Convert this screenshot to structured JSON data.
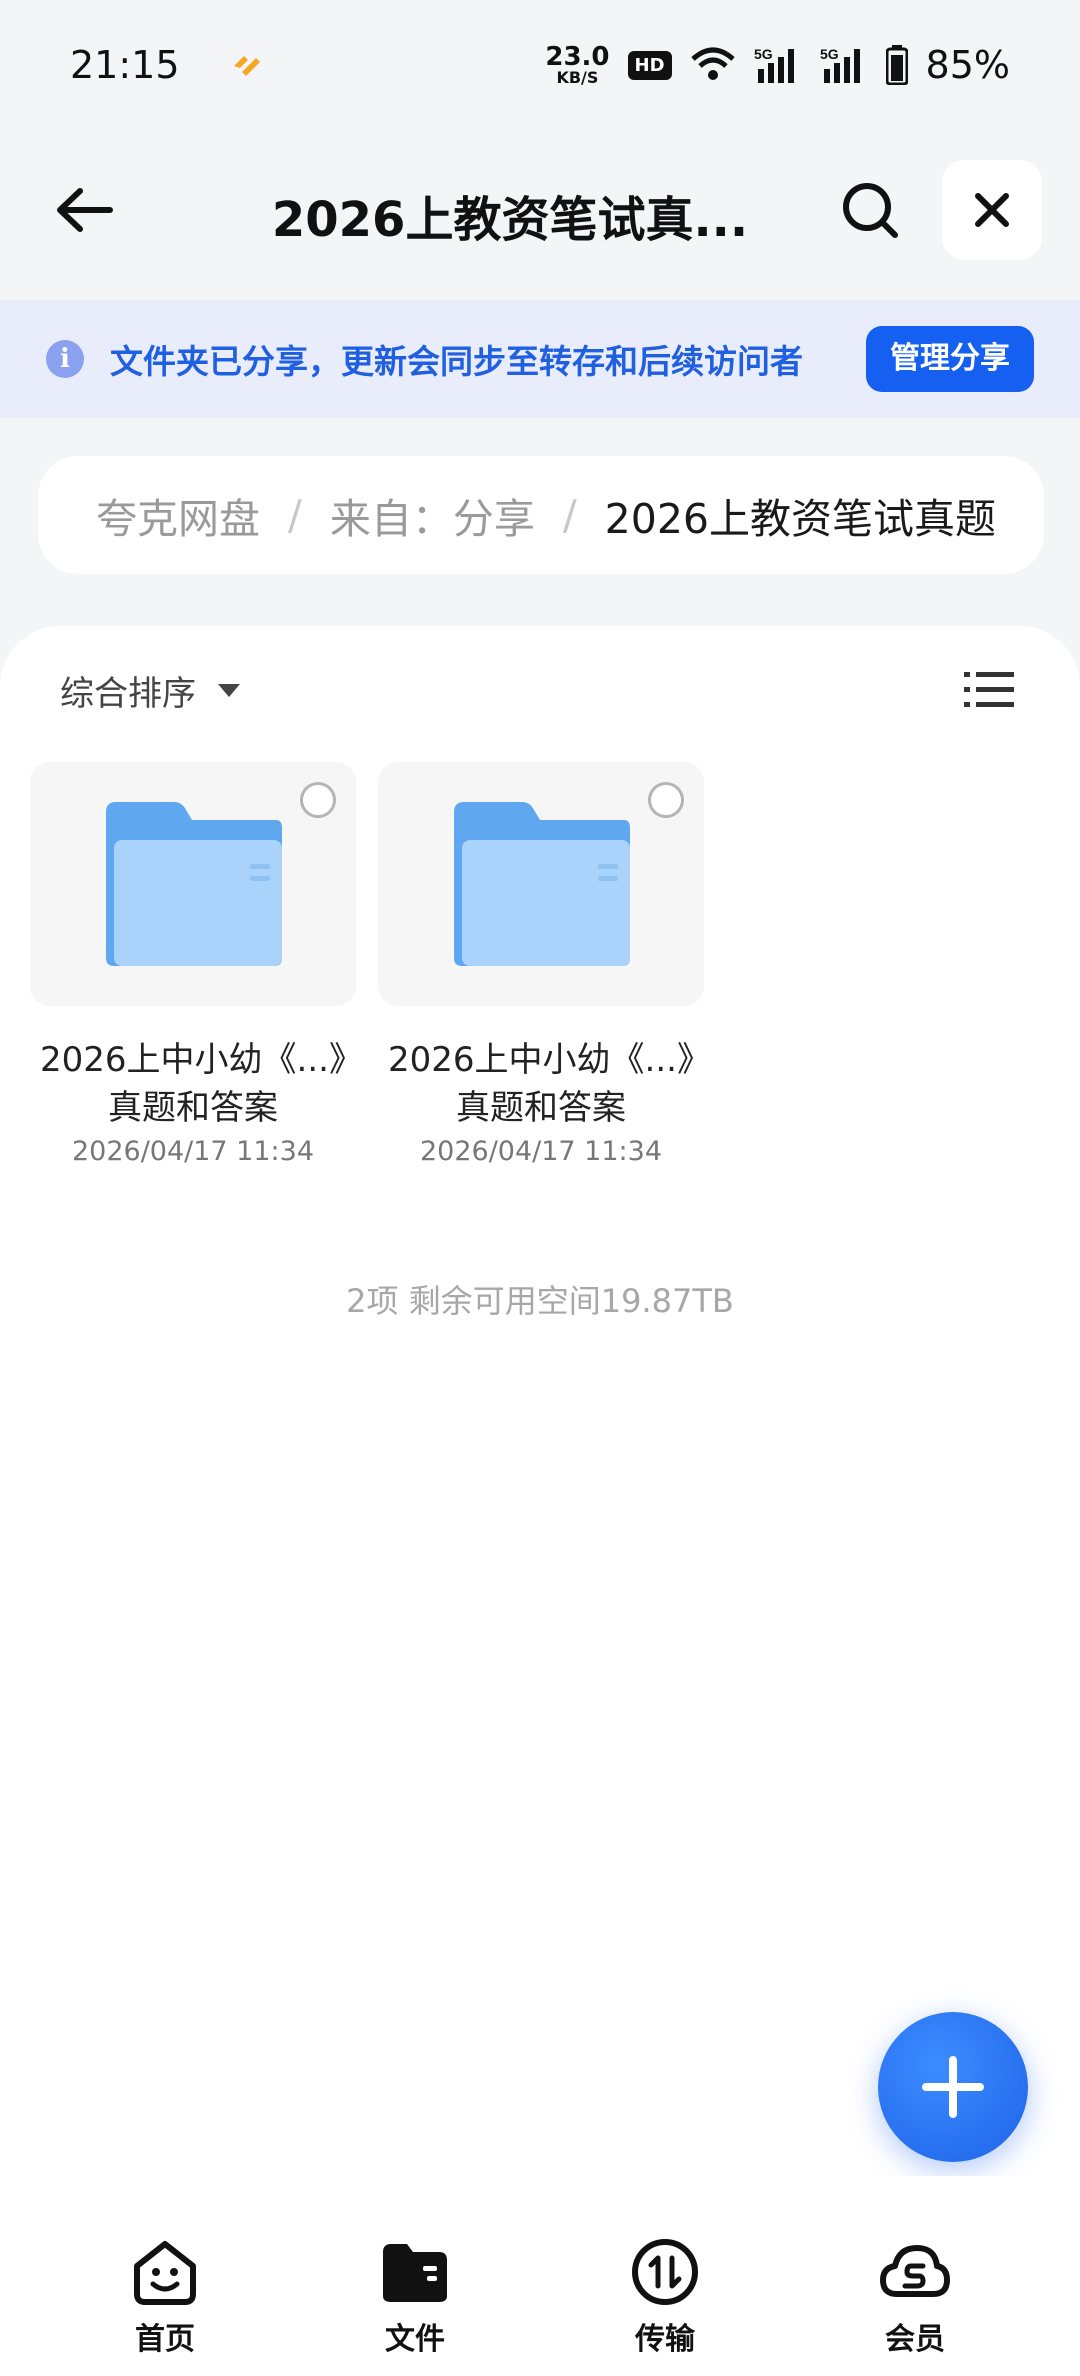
{
  "status_bar": {
    "time": "21:15",
    "net_speed_value": "23.0",
    "net_speed_unit": "KB/S",
    "hd_badge": "HD",
    "battery": "85%"
  },
  "header": {
    "title": "2026上教资笔试真...",
    "icons": [
      "back-arrow-icon",
      "search-icon",
      "close-icon"
    ]
  },
  "banner": {
    "message": "文件夹已分享，更新会同步至转存和后续访问者",
    "manage_button": "管理分享"
  },
  "breadcrumb": {
    "items": [
      "夸克网盘",
      "来自：分享",
      "2026上教资笔试真题"
    ],
    "separator": "/"
  },
  "toolbar": {
    "sort_label": "综合排序"
  },
  "files": [
    {
      "name": "2026上中小幼《...》真题和答案",
      "date": "2026/04/17 11:34"
    },
    {
      "name": "2026上中小幼《...》真题和答案",
      "date": "2026/04/17 11:34"
    }
  ],
  "footer_info": "2项 剩余可用空间19.87TB",
  "bottom_nav": [
    {
      "label": "首页",
      "icon": "home-face-icon"
    },
    {
      "label": "文件",
      "icon": "folder-icon"
    },
    {
      "label": "传输",
      "icon": "transfer-icon"
    },
    {
      "label": "会员",
      "icon": "cloud-vip-icon"
    }
  ],
  "colors": {
    "accent": "#1560f0",
    "banner_bg": "#e9ecfb",
    "folder": "#6fb4f2"
  }
}
